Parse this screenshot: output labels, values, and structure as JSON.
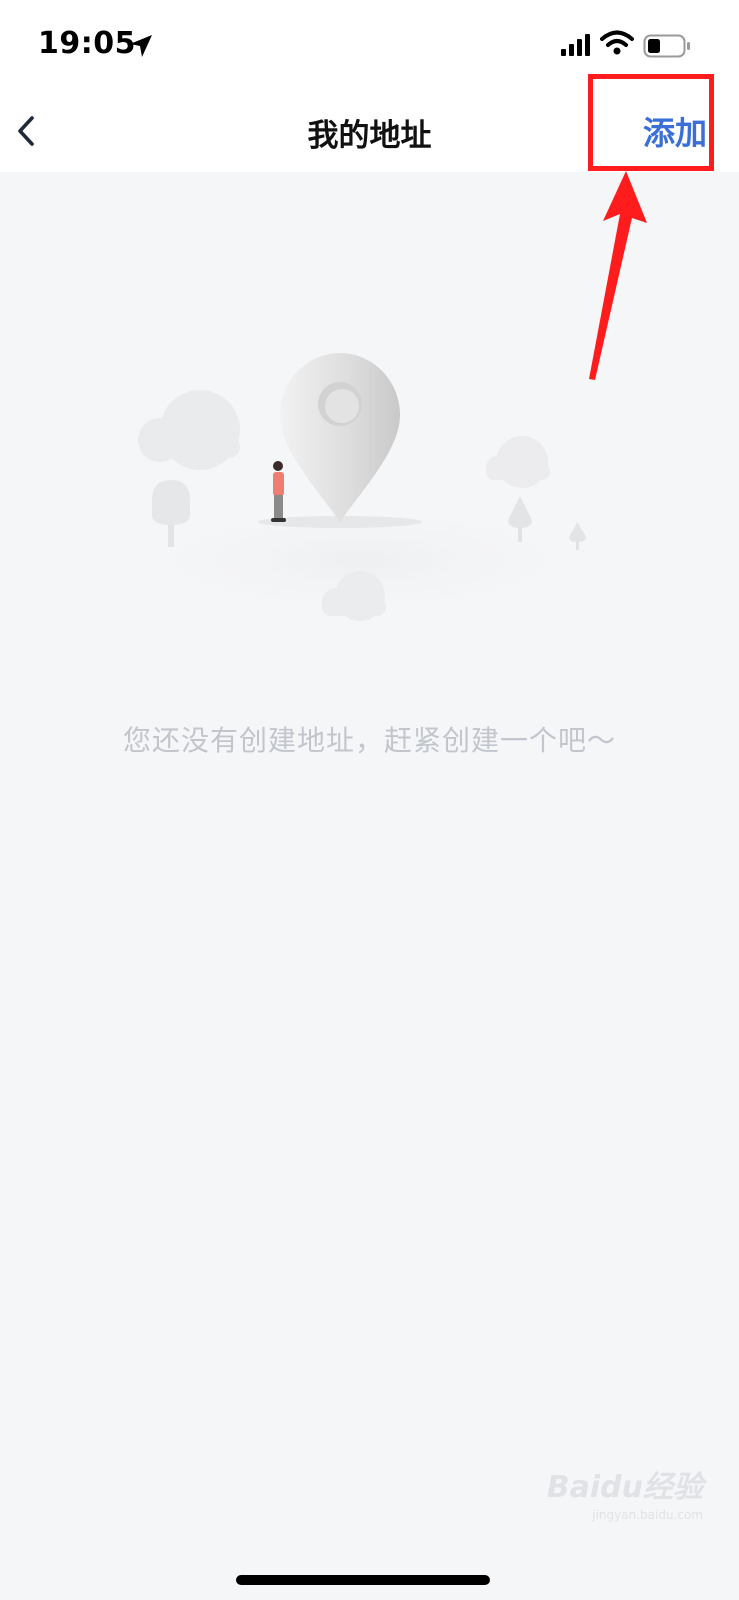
{
  "status_bar": {
    "time": "19:05",
    "icons": [
      "location-arrow-icon",
      "signal-icon",
      "wifi-icon",
      "battery-icon"
    ],
    "battery_level": 0.3
  },
  "nav": {
    "title": "我的地址",
    "back_icon": "chevron-left-icon",
    "add_label": "添加"
  },
  "empty_state": {
    "message": "您还没有创建地址，赶紧创建一个吧～"
  },
  "watermark": {
    "logo": "Baidu经验",
    "sub": "jingyan.baidu.com"
  },
  "colors": {
    "accent": "#3a6fd8",
    "annotation_red": "#ff1c1c",
    "background": "#f5f6f8"
  }
}
